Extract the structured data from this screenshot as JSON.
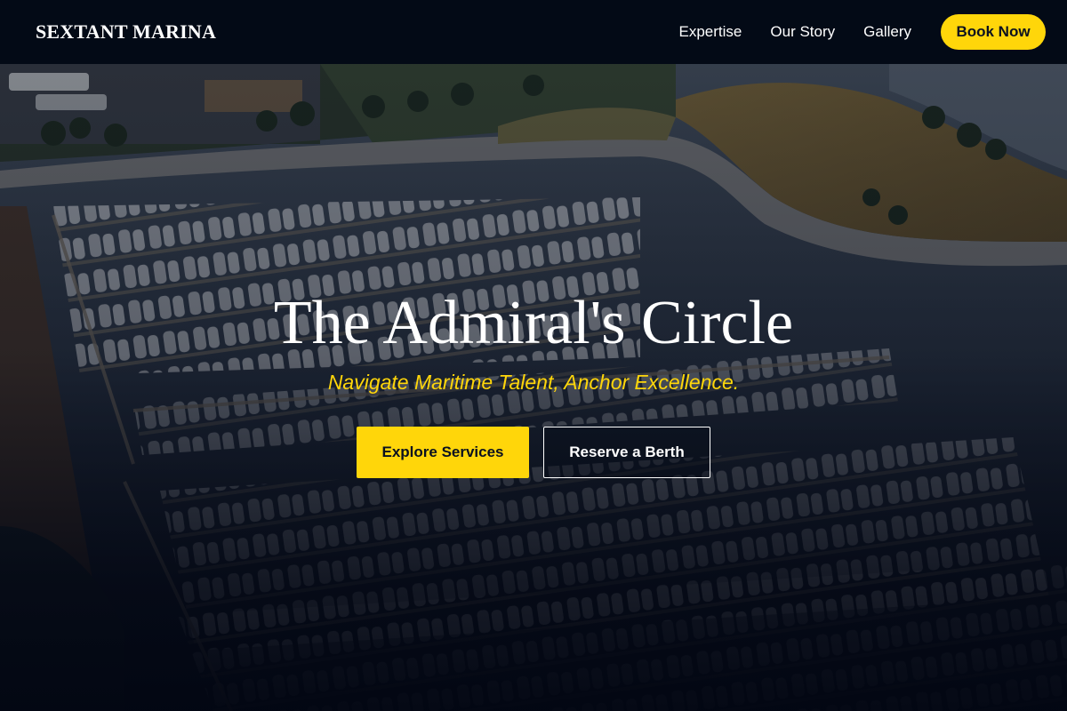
{
  "nav": {
    "brand": "SEXTANT MARINA",
    "links": [
      {
        "label": "Expertise"
      },
      {
        "label": "Our Story"
      },
      {
        "label": "Gallery"
      }
    ],
    "book_label": "Book Now"
  },
  "hero": {
    "title": "The Admiral's Circle",
    "tagline": "Navigate Maritime Talent, Anchor Excellence.",
    "primary_cta": "Explore Services",
    "secondary_cta": "Reserve a Berth",
    "background_description_icon": "marina-aerial-photo"
  },
  "colors": {
    "accent": "#ffd60a",
    "nav_bg": "#030a16",
    "text": "#ffffff"
  }
}
